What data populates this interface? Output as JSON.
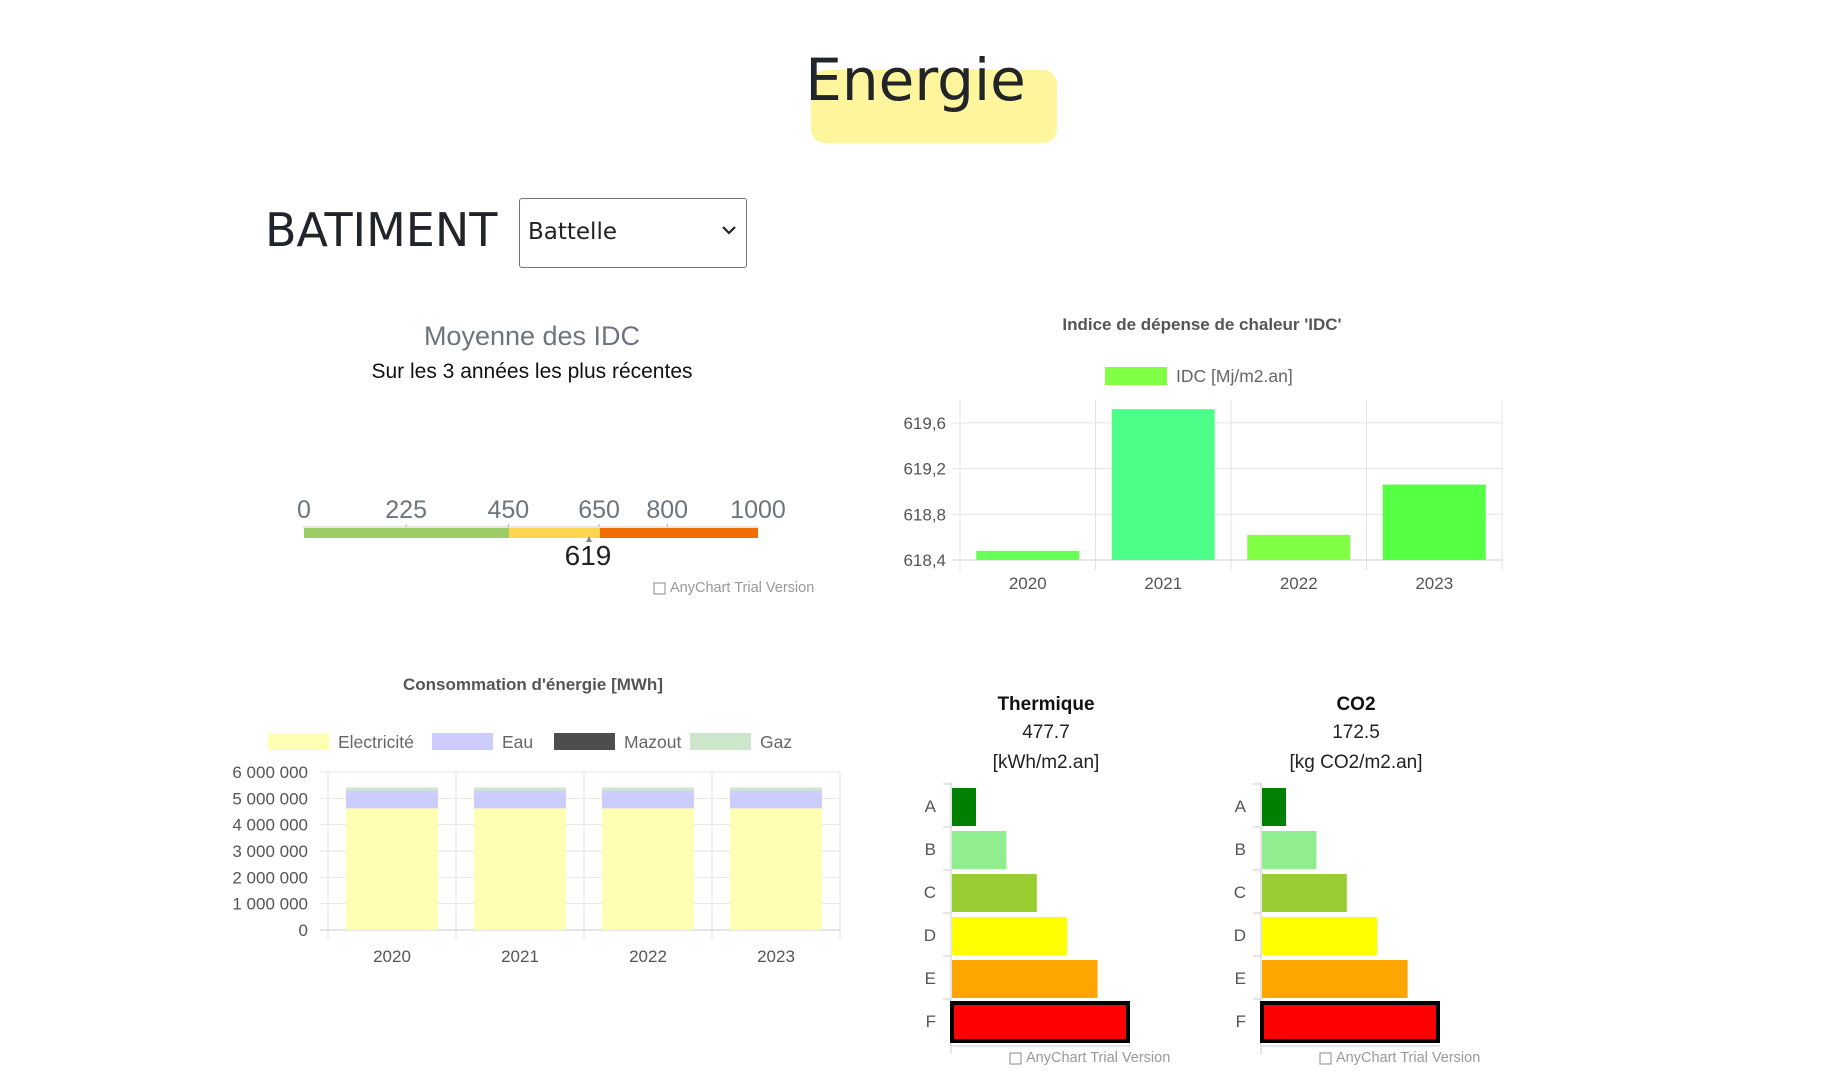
{
  "header": {
    "title": "Energie"
  },
  "batiment": {
    "label": "BATIMENT",
    "selected": "Battelle"
  },
  "gauge": {
    "title": "Moyenne des IDC",
    "subtitle": "Sur les 3 années les plus récentes",
    "ticks": [
      "0",
      "225",
      "450",
      "650",
      "800",
      "1000"
    ],
    "value_label": "619",
    "watermark": "AnyChart Trial Version"
  },
  "rating": {
    "categories": [
      "A",
      "B",
      "C",
      "D",
      "E",
      "F"
    ],
    "colors": [
      "#008000",
      "#90ee90",
      "#9acd32",
      "#ffff00",
      "#ffa500",
      "#ff0000"
    ],
    "thermique": {
      "title": "Thermique",
      "value": "477.7",
      "unit": "[kWh/m2.an]",
      "highlight": "F"
    },
    "co2": {
      "title": "CO2",
      "value": "172.5",
      "unit": "[kg CO2/m2.an]",
      "highlight": "F"
    },
    "watermark": "AnyChart Trial Version"
  },
  "chart_data": [
    {
      "type": "bar",
      "title": "Indice de dépense de chaleur 'IDC'",
      "categories": [
        "2020",
        "2021",
        "2022",
        "2023"
      ],
      "series": [
        {
          "name": "IDC [Mj/m2.an]",
          "values": [
            618.48,
            619.72,
            618.62,
            619.06
          ]
        }
      ],
      "bar_colors": [
        "#66ff55",
        "#4dff88",
        "#80ff44",
        "#55ff44"
      ],
      "legend_color": "#80ff44",
      "y_ticks": [
        "618,4",
        "618,8",
        "619,2",
        "619,6"
      ],
      "ylim": [
        618.4,
        619.8
      ],
      "grid": true,
      "legend": "top"
    },
    {
      "type": "bar",
      "stacked": true,
      "title": "Consommation d'énergie [MWh]",
      "categories": [
        "2020",
        "2021",
        "2022",
        "2023"
      ],
      "series": [
        {
          "name": "Electricité",
          "color": "#ffffb3",
          "values": [
            4620000,
            4620000,
            4620000,
            4620000
          ]
        },
        {
          "name": "Eau",
          "color": "#ccccff",
          "values": [
            680000,
            680000,
            680000,
            680000
          ]
        },
        {
          "name": "Mazout",
          "color": "#4d4d4d",
          "values": [
            0,
            0,
            0,
            0
          ]
        },
        {
          "name": "Gaz",
          "color": "#cce6cc",
          "values": [
            110000,
            110000,
            110000,
            110000
          ]
        }
      ],
      "y_ticks": [
        "0",
        "1 000 000",
        "2 000 000",
        "3 000 000",
        "4 000 000",
        "5 000 000",
        "6 000 000"
      ],
      "ylim": [
        0,
        6000000
      ],
      "grid": true,
      "legend": "top"
    }
  ]
}
